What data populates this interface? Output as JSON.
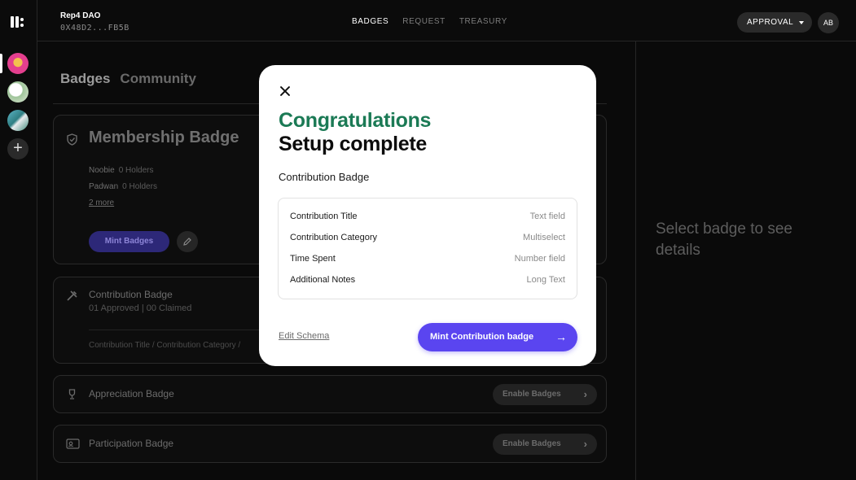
{
  "rail": {
    "add_label": "+"
  },
  "topbar": {
    "dao_name": "Rep4 DAO",
    "dao_address": "0X48D2...FB5B",
    "nav": [
      "BADGES",
      "REQUEST",
      "TREASURY"
    ],
    "nav_active": "BADGES",
    "approval_label": "APPROVAL",
    "avatar_initials": "AB"
  },
  "main": {
    "tabs": [
      "Badges",
      "Community"
    ],
    "membership": {
      "title": "Membership Badge",
      "levels": [
        {
          "name": "Noobie",
          "holders": "0 Holders"
        },
        {
          "name": "Padwan",
          "holders": "0 Holders"
        }
      ],
      "more_link": "2 more",
      "mint_label": "Mint Badges"
    },
    "contribution": {
      "title": "Contribution Badge",
      "subtitle": "01 Approved | 00 Claimed",
      "fields_preview": "Contribution Title / Contribution Category /"
    },
    "appreciation": {
      "title": "Appreciation Badge",
      "button_label": "Enable Badges"
    },
    "participation": {
      "title": "Participation Badge",
      "button_label": "Enable Badges"
    }
  },
  "detail": {
    "empty_text": "Select badge to see details"
  },
  "modal": {
    "heading_accent": "Congratulations",
    "heading": "Setup complete",
    "badge_name": "Contribution Badge",
    "fields": [
      {
        "name": "Contribution Title",
        "type": "Text field"
      },
      {
        "name": "Contribution Category",
        "type": "Multiselect"
      },
      {
        "name": "Time Spent",
        "type": "Number field"
      },
      {
        "name": "Additional Notes",
        "type": "Long Text"
      }
    ],
    "edit_schema_label": "Edit Schema",
    "mint_label": "Mint Contribution badge"
  },
  "colors": {
    "accent_green": "#1b7a55",
    "accent_purple": "#5a45f0"
  }
}
